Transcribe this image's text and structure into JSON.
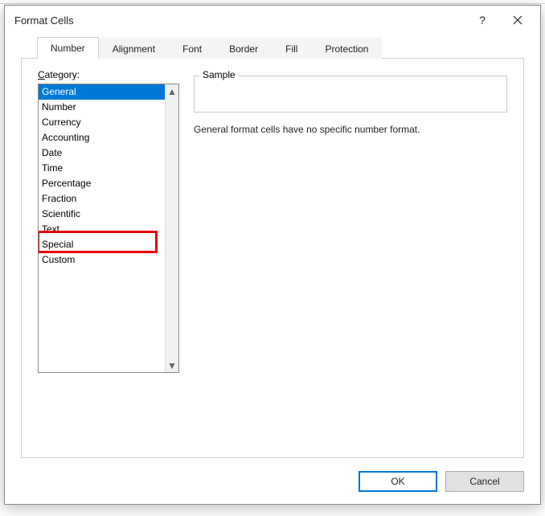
{
  "dialog": {
    "title": "Format Cells",
    "help_label": "?",
    "close_label": "✕"
  },
  "tabs": [
    {
      "label": "Number",
      "active": true
    },
    {
      "label": "Alignment",
      "active": false
    },
    {
      "label": "Font",
      "active": false
    },
    {
      "label": "Border",
      "active": false
    },
    {
      "label": "Fill",
      "active": false
    },
    {
      "label": "Protection",
      "active": false
    }
  ],
  "category": {
    "label_pre": "C",
    "label_rest": "ategory:",
    "items": [
      {
        "label": "General",
        "selected": true
      },
      {
        "label": "Number"
      },
      {
        "label": "Currency"
      },
      {
        "label": "Accounting"
      },
      {
        "label": "Date"
      },
      {
        "label": "Time"
      },
      {
        "label": "Percentage"
      },
      {
        "label": "Fraction"
      },
      {
        "label": "Scientific"
      },
      {
        "label": "Text"
      },
      {
        "label": "Special"
      },
      {
        "label": "Custom",
        "highlighted": true
      }
    ]
  },
  "sample": {
    "legend": "Sample",
    "value": ""
  },
  "description": "General format cells have no specific number format.",
  "buttons": {
    "ok": "OK",
    "cancel": "Cancel"
  },
  "scroll": {
    "up": "▲",
    "down": "▼"
  }
}
